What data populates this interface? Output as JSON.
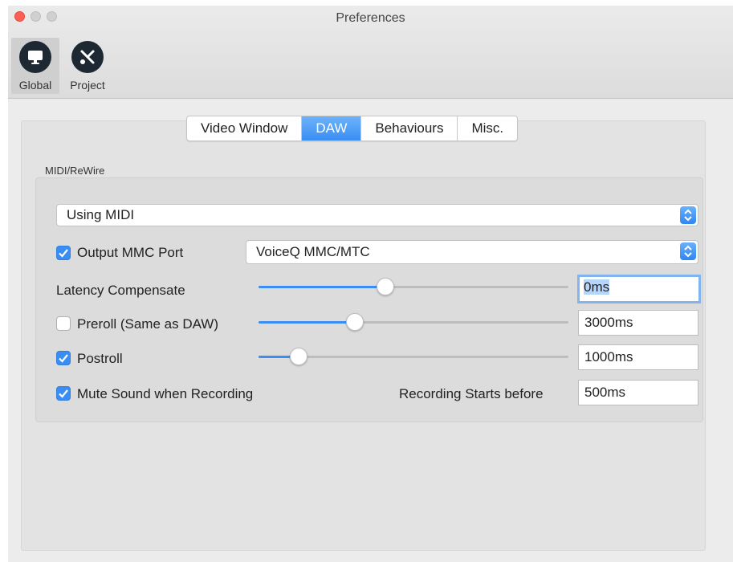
{
  "window": {
    "title": "Preferences"
  },
  "toolbar": {
    "items": [
      {
        "label": "Global",
        "icon": "monitor-icon",
        "selected": true
      },
      {
        "label": "Project",
        "icon": "tools-icon",
        "selected": false
      }
    ]
  },
  "tabs": [
    {
      "label": "Video Window",
      "active": false
    },
    {
      "label": "DAW",
      "active": true
    },
    {
      "label": "Behaviours",
      "active": false
    },
    {
      "label": "Misc.",
      "active": false
    }
  ],
  "midi": {
    "group_label": "MIDI/ReWire",
    "mode_select": "Using MIDI",
    "output_mmc": {
      "label": "Output MMC Port",
      "checked": true,
      "port": "VoiceQ MMC/MTC"
    },
    "latency": {
      "label": "Latency Compensate",
      "value": "0ms",
      "slider": 0.41
    },
    "preroll": {
      "label": "Preroll (Same as DAW)",
      "checked": false,
      "value": "3000ms",
      "slider": 0.31
    },
    "postroll": {
      "label": "Postroll",
      "checked": true,
      "value": "1000ms",
      "slider": 0.13
    },
    "mute": {
      "label": "Mute Sound when Recording",
      "checked": true
    },
    "recording_starts": {
      "label": "Recording Starts before",
      "value": "500ms"
    }
  },
  "colors": {
    "accent": "#3a8ef3",
    "icon_bg": "#1d2833"
  }
}
